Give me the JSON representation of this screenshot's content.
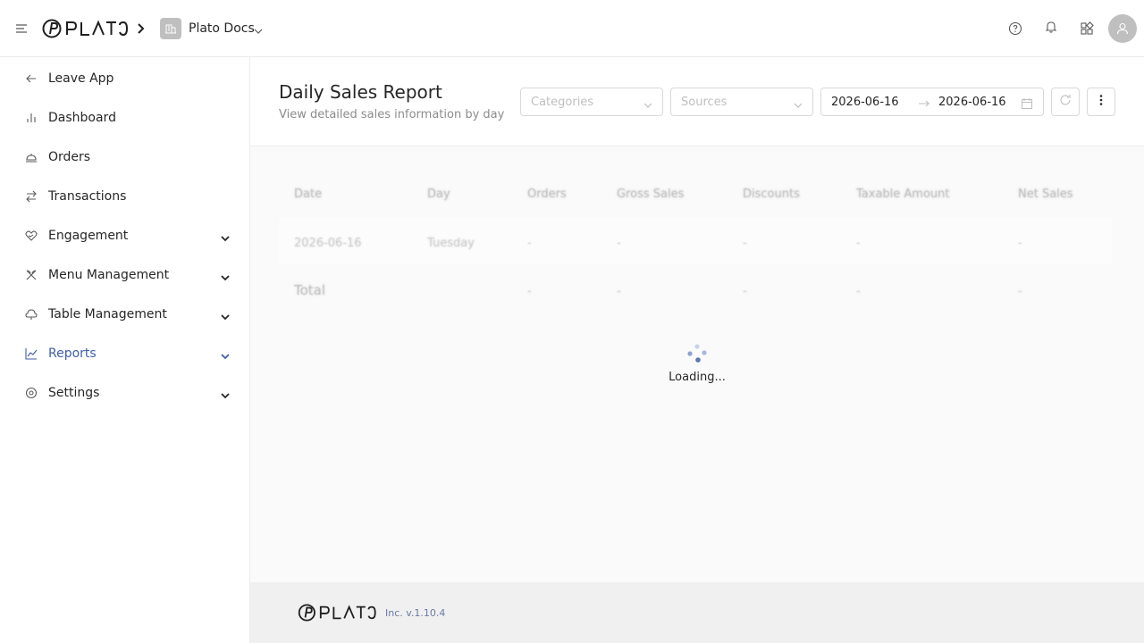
{
  "header": {
    "brand": "PLATO",
    "workspace_name": "Plato Docs",
    "icons": [
      "menu-icon",
      "help-icon",
      "bell-icon",
      "apps-icon",
      "user-icon"
    ]
  },
  "sidebar": {
    "items": [
      {
        "label": "Leave App",
        "icon": "arrow-left-icon",
        "expandable": false
      },
      {
        "label": "Dashboard",
        "icon": "bar-chart-icon",
        "expandable": false
      },
      {
        "label": "Orders",
        "icon": "cloche-icon",
        "expandable": false
      },
      {
        "label": "Transactions",
        "icon": "swap-icon",
        "expandable": false
      },
      {
        "label": "Engagement",
        "icon": "heart-hand-icon",
        "expandable": true
      },
      {
        "label": "Menu Management",
        "icon": "utensils-icon",
        "expandable": true
      },
      {
        "label": "Table Management",
        "icon": "table-icon",
        "expandable": true
      },
      {
        "label": "Reports",
        "icon": "line-chart-icon",
        "expandable": true,
        "active": true
      },
      {
        "label": "Settings",
        "icon": "settings-icon",
        "expandable": true
      }
    ],
    "accent_color": "#3f5fa6"
  },
  "page": {
    "title": "Daily Sales Report",
    "subtitle": "View detailed sales information by day",
    "filters": {
      "categories_placeholder": "Categories",
      "sources_placeholder": "Sources",
      "date_from": "2026-06-16",
      "date_to": "2026-06-16"
    }
  },
  "table": {
    "columns": [
      "Date",
      "Day",
      "Orders",
      "Gross Sales",
      "Discounts",
      "Taxable Amount",
      "Net Sales"
    ],
    "rows": [
      [
        "2026-06-16",
        "Tuesday",
        "-",
        "-",
        "-",
        "-",
        "-"
      ]
    ],
    "totals": [
      "Total",
      "",
      "-",
      "-",
      "-",
      "-",
      "-"
    ]
  },
  "loading_text": "Loading...",
  "footer": {
    "brand": "PLATO",
    "version": "Inc. v.1.10.4"
  }
}
